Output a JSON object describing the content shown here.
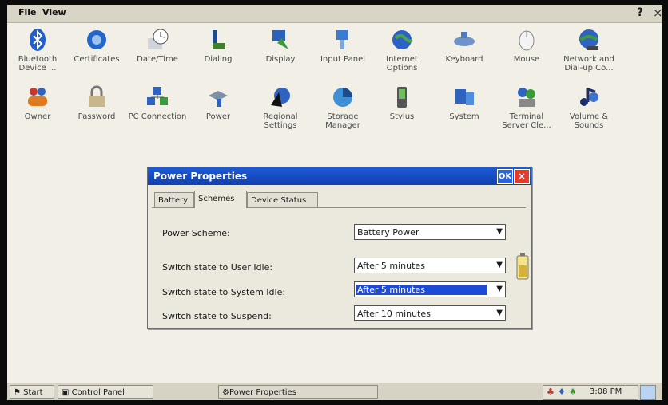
{
  "menu": {
    "file": "File",
    "view": "View",
    "help": "?",
    "close": "×"
  },
  "icons": [
    {
      "label": "Bluetooth Device ...",
      "icon": "bluetooth-icon"
    },
    {
      "label": "Certificates",
      "icon": "certificates-icon"
    },
    {
      "label": "Date/Time",
      "icon": "clock-icon"
    },
    {
      "label": "Dialing",
      "icon": "phone-icon"
    },
    {
      "label": "Display",
      "icon": "display-icon"
    },
    {
      "label": "Input Panel",
      "icon": "input-panel-icon"
    },
    {
      "label": "Internet Options",
      "icon": "globe-icon"
    },
    {
      "label": "Keyboard",
      "icon": "keyboard-icon"
    },
    {
      "label": "Mouse",
      "icon": "mouse-icon"
    },
    {
      "label": "Network and Dial-up Co...",
      "icon": "network-icon"
    },
    {
      "label": "Owner",
      "icon": "owner-icon"
    },
    {
      "label": "Password",
      "icon": "lock-icon"
    },
    {
      "label": "PC Connection",
      "icon": "pc-connection-icon"
    },
    {
      "label": "Power",
      "icon": "power-icon"
    },
    {
      "label": "Regional Settings",
      "icon": "regional-icon"
    },
    {
      "label": "Storage Manager",
      "icon": "storage-icon"
    },
    {
      "label": "Stylus",
      "icon": "stylus-icon"
    },
    {
      "label": "System",
      "icon": "system-icon"
    },
    {
      "label": "Terminal Server Cle...",
      "icon": "terminal-icon"
    },
    {
      "label": "Volume & Sounds",
      "icon": "volume-icon"
    }
  ],
  "dialog": {
    "title": "Power Properties",
    "ok": "OK",
    "close": "×",
    "tabs": [
      "Battery",
      "Schemes",
      "Device Status"
    ],
    "active_tab": "Schemes",
    "rows": [
      {
        "label": "Power Scheme:",
        "value": "Battery Power"
      },
      {
        "label": "Switch state to User Idle:",
        "value": "After 5 minutes"
      },
      {
        "label": "Switch state to System Idle:",
        "value": "After 5 minutes"
      },
      {
        "label": "Switch state to Suspend:",
        "value": "After 10 minutes"
      }
    ]
  },
  "taskbar": {
    "start": "Start",
    "control_panel": "Control Panel",
    "power_properties": "Power Properties",
    "time": "3:08 PM"
  },
  "colors": {
    "title_bar": "#1e5ad6",
    "close": "#e23b2c",
    "selection": "#1e4bd6",
    "desktop": "#f1efe6"
  }
}
